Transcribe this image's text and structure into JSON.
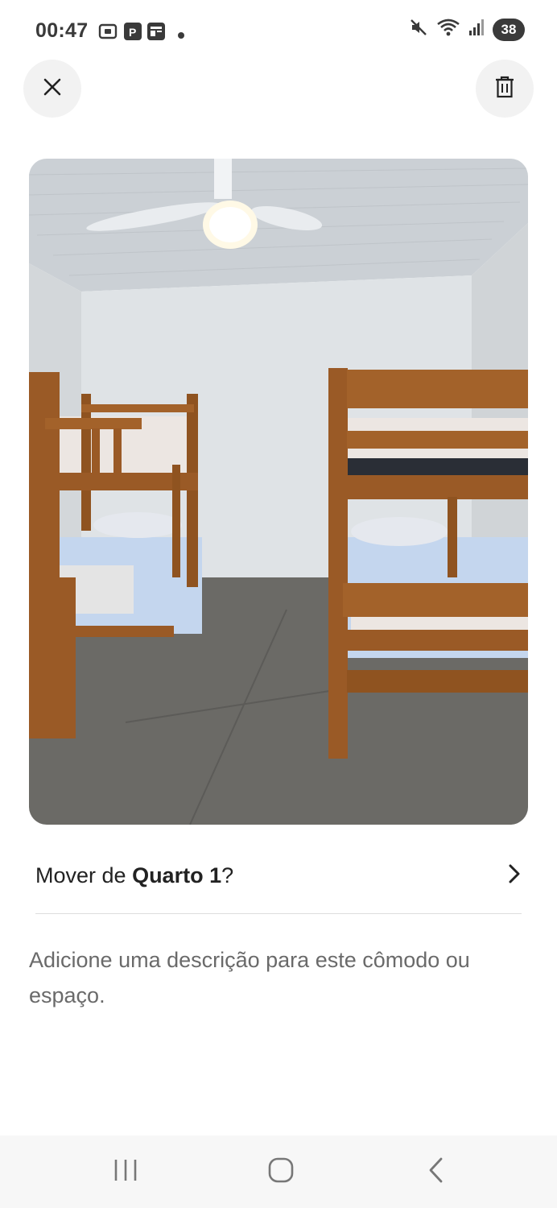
{
  "status_bar": {
    "time": "00:47",
    "battery": "38",
    "left_icons": [
      "screenshot-icon",
      "parking-app-icon",
      "news-app-icon",
      "notification-dot-icon"
    ],
    "right_icons": [
      "mute-icon",
      "wifi-icon",
      "signal-icon",
      "battery-icon"
    ]
  },
  "header": {
    "close_icon": "close-icon",
    "delete_icon": "trash-icon"
  },
  "photo": {
    "subject": "bedroom-with-two-bunk-beds",
    "colors": {
      "ceiling": "#cfd3d8",
      "wall": "#dfe3e7",
      "floor": "#6b6a66",
      "wood": "#9a5a26",
      "sheet": "#c9d8ee"
    }
  },
  "move_row": {
    "prefix": "Mover de ",
    "room": "Quarto 1",
    "suffix": "?",
    "chevron_icon": "chevron-right-icon"
  },
  "description": {
    "placeholder": "Adicione uma descrição para este cômodo ou espaço."
  },
  "nav_bar": {
    "recents_icon": "recent-apps-icon",
    "home_icon": "home-icon",
    "back_icon": "back-icon"
  }
}
